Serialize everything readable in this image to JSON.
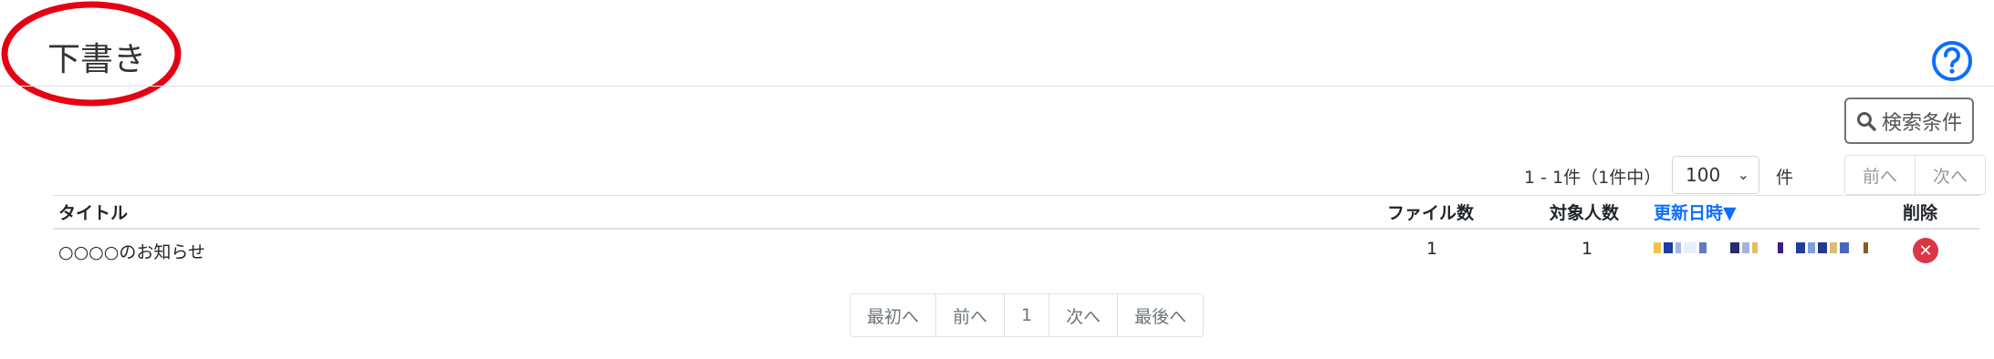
{
  "page": {
    "title": "下書き"
  },
  "toolbar": {
    "search_label": "検索条件",
    "result_count": "1 - 1件（1件中）",
    "per_page_value": "100",
    "per_page_unit": "件",
    "prev_label": "前へ",
    "next_label": "次へ"
  },
  "table": {
    "columns": {
      "title": "タイトル",
      "file_count": "ファイル数",
      "recipients": "対象人数",
      "updated": "更新日時▼",
      "delete": "削除"
    },
    "rows": [
      {
        "title": "○○○○のお知らせ",
        "file_count": "1",
        "recipients": "1"
      }
    ]
  },
  "pagination": {
    "first": "最初へ",
    "prev": "前へ",
    "current": "1",
    "next": "次へ",
    "last": "最後へ"
  },
  "colors": {
    "accent": "#0d6efd",
    "danger": "#dc3545",
    "annotation_red": "#e60012"
  }
}
